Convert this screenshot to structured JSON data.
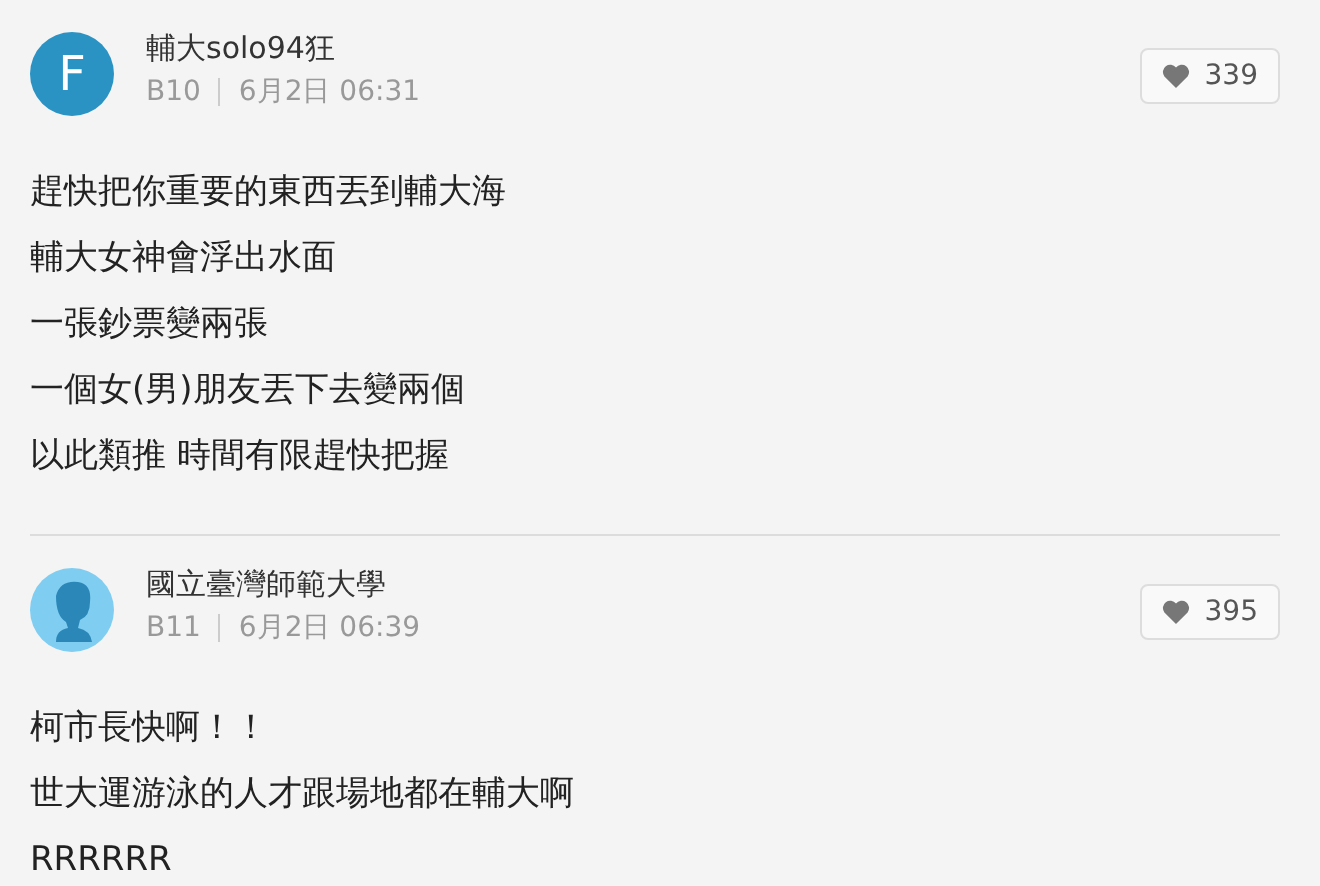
{
  "posts": [
    {
      "avatar": {
        "kind": "letter",
        "letter": "F"
      },
      "author": "輔大solo94狂",
      "floor": "B10",
      "time": "6月2日 06:31",
      "likes": "339",
      "lines": [
        "趕快把你重要的東西丟到輔大海",
        "輔大女神會浮出水面",
        "一張鈔票變兩張",
        "一個女(男)朋友丟下去變兩個",
        "以此類推 時間有限趕快把握"
      ]
    },
    {
      "avatar": {
        "kind": "silhouette"
      },
      "author": "國立臺灣師範大學",
      "floor": "B11",
      "time": "6月2日 06:39",
      "likes": "395",
      "lines": [
        "柯市長快啊！！",
        "世大運游泳的人才跟場地都在輔大啊",
        "RRRRRR"
      ]
    }
  ]
}
